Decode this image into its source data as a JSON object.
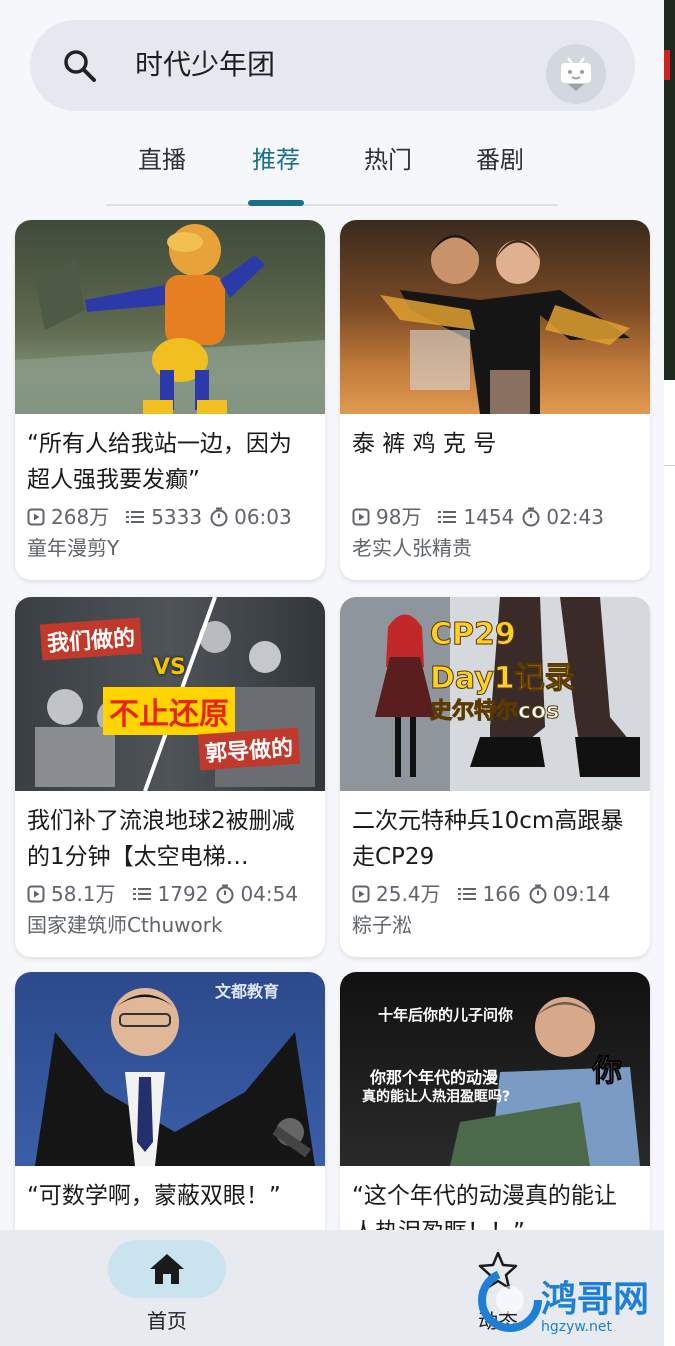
{
  "search": {
    "query": "时代少年团"
  },
  "tabs": [
    {
      "label": "直播"
    },
    {
      "label": "推荐",
      "active": true
    },
    {
      "label": "热门"
    },
    {
      "label": "番剧"
    }
  ],
  "videos": [
    {
      "title": "“所有人给我站一边，因为超人强我要发癫”",
      "views": "268万",
      "danmaku": "5333",
      "duration": "06:03",
      "author": "童年漫剪Y"
    },
    {
      "title": "泰 裤 鸡 克 号",
      "views": "98万",
      "danmaku": "1454",
      "duration": "02:43",
      "author": "老实人张精贵"
    },
    {
      "title": "我们补了流浪地球2被删减的1分钟【太空电梯…",
      "views": "58.1万",
      "danmaku": "1792",
      "duration": "04:54",
      "author": "国家建筑师Cthuwork",
      "overlay": {
        "top": "我们做的",
        "vs": "VS",
        "main": "不止还原",
        "bottom": "郭导做的"
      }
    },
    {
      "title": "二次元特种兵10cm高跟暴走CP29",
      "views": "25.4万",
      "danmaku": "166",
      "duration": "09:14",
      "author": "粽子淞",
      "overlay": {
        "line1": "CP29",
        "line2": "Day1记录",
        "line3": "史尔特尔cos"
      }
    },
    {
      "title": "“可数学啊，蒙蔽双眼！”",
      "overlay": {
        "brand": "文都教育"
      }
    },
    {
      "title": "“这个年代的动漫真的能让人热泪盈眶！！”",
      "overlay": {
        "line1": "十年后你的儿子问你",
        "line2": "你那个年代的动漫",
        "line3": "真的能让人热泪盈眶吗?",
        "big": "你"
      }
    }
  ],
  "bottom_nav": [
    {
      "label": "首页",
      "icon": "home-icon",
      "active": true
    },
    {
      "label": "动态",
      "icon": "star-icon"
    }
  ],
  "watermark": {
    "name": "鸿哥网",
    "url": "hgzyw.net"
  },
  "colors": {
    "accent": "#1b6f89",
    "home_pill": "#c9e3ef",
    "search_bg": "#e5e9ef"
  }
}
